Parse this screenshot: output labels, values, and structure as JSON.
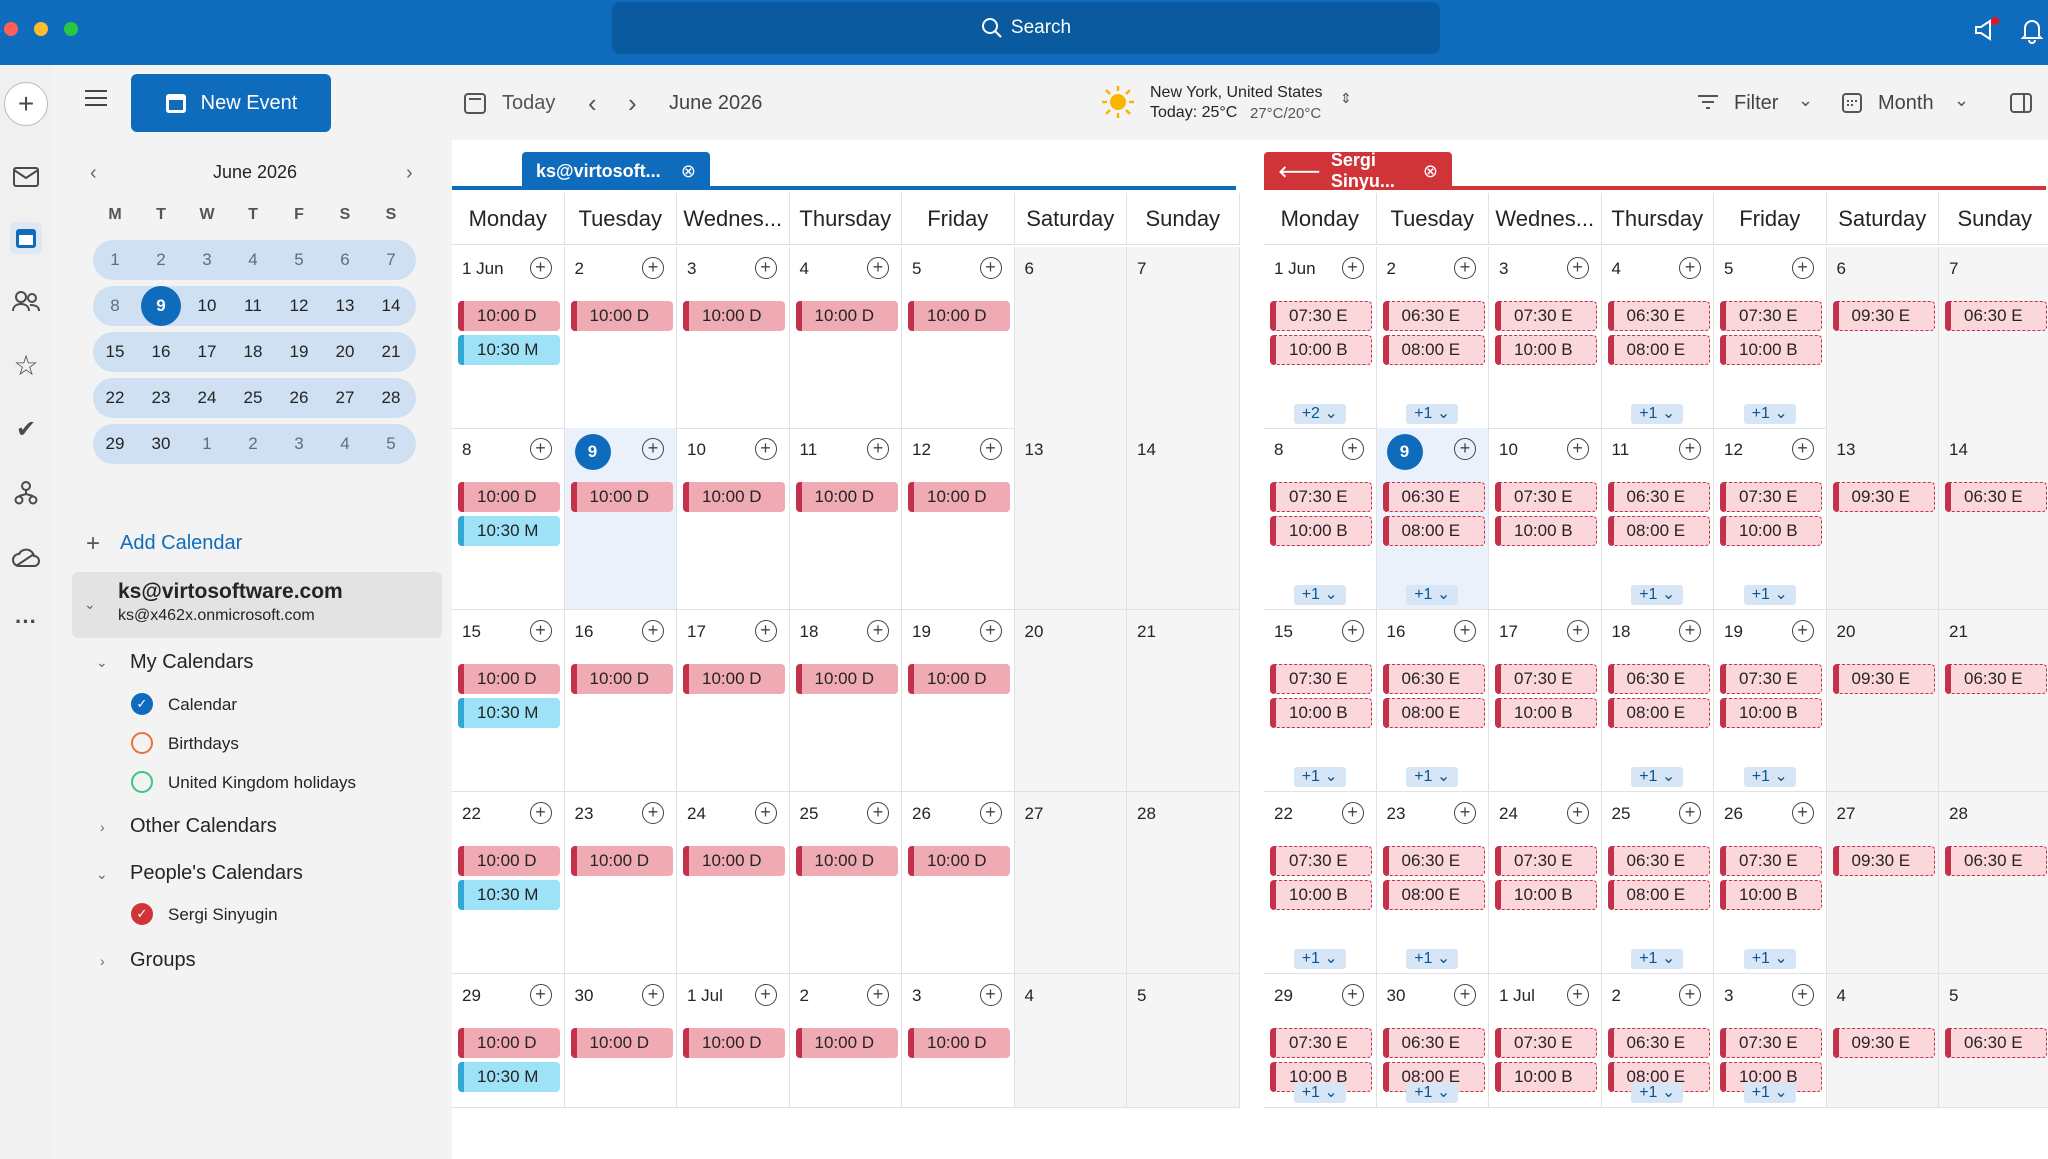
{
  "search": {
    "label": "Search"
  },
  "rail": {
    "items": [
      "add-icon",
      "mail-icon",
      "calendar-icon",
      "people-icon",
      "star-icon",
      "todo-icon",
      "org-icon",
      "cloud-icon",
      "more-icon"
    ]
  },
  "sidebar": {
    "new_event": "New Event",
    "mini_calendar": {
      "title": "June 2026",
      "dow": [
        "M",
        "T",
        "W",
        "T",
        "F",
        "S",
        "S"
      ],
      "weeks": [
        [
          "1",
          "2",
          "3",
          "4",
          "5",
          "6",
          "7"
        ],
        [
          "8",
          "9",
          "10",
          "11",
          "12",
          "13",
          "14"
        ],
        [
          "15",
          "16",
          "17",
          "18",
          "19",
          "20",
          "21"
        ],
        [
          "22",
          "23",
          "24",
          "25",
          "26",
          "27",
          "28"
        ],
        [
          "29",
          "30",
          "1",
          "2",
          "3",
          "4",
          "5"
        ]
      ],
      "today": "9"
    },
    "add_calendar": "Add Calendar",
    "account": {
      "name": "ks@virtosoftware.com",
      "email": "ks@x462x.onmicrosoft.com"
    },
    "my_calendars": "My Calendars",
    "calendars": [
      {
        "label": "Calendar",
        "color": "#0f6cbd",
        "checked": true
      },
      {
        "label": "Birthdays",
        "color": "#e8743b",
        "checked": false
      },
      {
        "label": "United Kingdom holidays",
        "color": "#3cc480",
        "checked": false
      }
    ],
    "other_calendars": "Other Calendars",
    "peoples_calendars": "People's Calendars",
    "people": [
      {
        "label": "Sergi Sinyugin",
        "color": "#d13438",
        "checked": true
      }
    ],
    "groups": "Groups"
  },
  "toolbar": {
    "today": "Today",
    "period": "June 2026",
    "weather": {
      "location": "New York, United States",
      "today": "Today: 25°C",
      "range": "27°C/20°C"
    },
    "filter": "Filter",
    "view": "Month"
  },
  "panes": [
    {
      "tab": "ks@virtosoft...",
      "accent": "#0f6cbd",
      "dow": [
        "Monday",
        "Tuesday",
        "Wednes...",
        "Thursday",
        "Friday",
        "Saturday",
        "Sunday"
      ],
      "weeks": [
        {
          "days": [
            "1 Jun",
            "2",
            "3",
            "4",
            "5",
            "6",
            "7"
          ],
          "events": [
            [
              [
                "10:00 D",
                "red"
              ],
              [
                "10:30 M",
                "blue"
              ]
            ],
            [
              [
                "10:00 D",
                "red"
              ]
            ],
            [
              [
                "10:00 D",
                "red"
              ]
            ],
            [
              [
                "10:00 D",
                "red"
              ]
            ],
            [
              [
                "10:00 D",
                "red"
              ]
            ],
            [],
            []
          ],
          "more": [
            "",
            "",
            "",
            "",
            "",
            "",
            ""
          ]
        },
        {
          "days": [
            "8",
            "9",
            "10",
            "11",
            "12",
            "13",
            "14"
          ],
          "events": [
            [
              [
                "10:00 D",
                "red"
              ],
              [
                "10:30 M",
                "blue"
              ]
            ],
            [
              [
                "10:00 D",
                "red"
              ]
            ],
            [
              [
                "10:00 D",
                "red"
              ]
            ],
            [
              [
                "10:00 D",
                "red"
              ]
            ],
            [
              [
                "10:00 D",
                "red"
              ]
            ],
            [],
            []
          ],
          "more": [
            "",
            "",
            "",
            "",
            "",
            "",
            ""
          ]
        },
        {
          "days": [
            "15",
            "16",
            "17",
            "18",
            "19",
            "20",
            "21"
          ],
          "events": [
            [
              [
                "10:00 D",
                "red"
              ],
              [
                "10:30 M",
                "blue"
              ]
            ],
            [
              [
                "10:00 D",
                "red"
              ]
            ],
            [
              [
                "10:00 D",
                "red"
              ]
            ],
            [
              [
                "10:00 D",
                "red"
              ]
            ],
            [
              [
                "10:00 D",
                "red"
              ]
            ],
            [],
            []
          ],
          "more": [
            "",
            "",
            "",
            "",
            "",
            "",
            ""
          ]
        },
        {
          "days": [
            "22",
            "23",
            "24",
            "25",
            "26",
            "27",
            "28"
          ],
          "events": [
            [
              [
                "10:00 D",
                "red"
              ],
              [
                "10:30 M",
                "blue"
              ]
            ],
            [
              [
                "10:00 D",
                "red"
              ]
            ],
            [
              [
                "10:00 D",
                "red"
              ]
            ],
            [
              [
                "10:00 D",
                "red"
              ]
            ],
            [
              [
                "10:00 D",
                "red"
              ]
            ],
            [],
            []
          ],
          "more": [
            "",
            "",
            "",
            "",
            "",
            "",
            ""
          ]
        },
        {
          "days": [
            "29",
            "30",
            "1 Jul",
            "2",
            "3",
            "4",
            "5"
          ],
          "events": [
            [
              [
                "10:00 D",
                "red"
              ],
              [
                "10:30 M",
                "blue"
              ]
            ],
            [
              [
                "10:00 D",
                "red"
              ]
            ],
            [
              [
                "10:00 D",
                "red"
              ]
            ],
            [
              [
                "10:00 D",
                "red"
              ]
            ],
            [
              [
                "10:00 D",
                "red"
              ]
            ],
            [],
            []
          ],
          "more": [
            "",
            "",
            "",
            "",
            "",
            "",
            ""
          ]
        }
      ]
    },
    {
      "tab": "Sergi Sinyu...",
      "accent": "#d13438",
      "dow": [
        "Monday",
        "Tuesday",
        "Wednes...",
        "Thursday",
        "Friday",
        "Saturday",
        "Sunday"
      ],
      "weeks": [
        {
          "days": [
            "1 Jun",
            "2",
            "3",
            "4",
            "5",
            "6",
            "7"
          ],
          "events": [
            [
              [
                "07:30 E",
                "dash"
              ],
              [
                "10:00 B",
                "dash"
              ]
            ],
            [
              [
                "06:30 E",
                "dash"
              ],
              [
                "08:00 E",
                "dash"
              ]
            ],
            [
              [
                "07:30 E",
                "dash"
              ],
              [
                "10:00 B",
                "dash"
              ]
            ],
            [
              [
                "06:30 E",
                "dash"
              ],
              [
                "08:00 E",
                "dash"
              ]
            ],
            [
              [
                "07:30 E",
                "dash"
              ],
              [
                "10:00 B",
                "dash"
              ]
            ],
            [
              [
                "09:30 E",
                "dash"
              ]
            ],
            [
              [
                "06:30 E",
                "dash"
              ]
            ]
          ],
          "more": [
            "+2 ⌄",
            "+1 ⌄",
            "",
            "+1 ⌄",
            "+1 ⌄",
            "",
            ""
          ]
        },
        {
          "days": [
            "8",
            "9",
            "10",
            "11",
            "12",
            "13",
            "14"
          ],
          "events": [
            [
              [
                "07:30 E",
                "dash"
              ],
              [
                "10:00 B",
                "dash"
              ]
            ],
            [
              [
                "06:30 E",
                "dash"
              ],
              [
                "08:00 E",
                "dash"
              ]
            ],
            [
              [
                "07:30 E",
                "dash"
              ],
              [
                "10:00 B",
                "dash"
              ]
            ],
            [
              [
                "06:30 E",
                "dash"
              ],
              [
                "08:00 E",
                "dash"
              ]
            ],
            [
              [
                "07:30 E",
                "dash"
              ],
              [
                "10:00 B",
                "dash"
              ]
            ],
            [
              [
                "09:30 E",
                "dash"
              ]
            ],
            [
              [
                "06:30 E",
                "dash"
              ]
            ]
          ],
          "more": [
            "+1 ⌄",
            "+1 ⌄",
            "",
            "+1 ⌄",
            "+1 ⌄",
            "",
            ""
          ]
        },
        {
          "days": [
            "15",
            "16",
            "17",
            "18",
            "19",
            "20",
            "21"
          ],
          "events": [
            [
              [
                "07:30 E",
                "dash"
              ],
              [
                "10:00 B",
                "dash"
              ]
            ],
            [
              [
                "06:30 E",
                "dash"
              ],
              [
                "08:00 E",
                "dash"
              ]
            ],
            [
              [
                "07:30 E",
                "dash"
              ],
              [
                "10:00 B",
                "dash"
              ]
            ],
            [
              [
                "06:30 E",
                "dash"
              ],
              [
                "08:00 E",
                "dash"
              ]
            ],
            [
              [
                "07:30 E",
                "dash"
              ],
              [
                "10:00 B",
                "dash"
              ]
            ],
            [
              [
                "09:30 E",
                "dash"
              ]
            ],
            [
              [
                "06:30 E",
                "dash"
              ]
            ]
          ],
          "more": [
            "+1 ⌄",
            "+1 ⌄",
            "",
            "+1 ⌄",
            "+1 ⌄",
            "",
            ""
          ]
        },
        {
          "days": [
            "22",
            "23",
            "24",
            "25",
            "26",
            "27",
            "28"
          ],
          "events": [
            [
              [
                "07:30 E",
                "dash"
              ],
              [
                "10:00 B",
                "dash"
              ]
            ],
            [
              [
                "06:30 E",
                "dash"
              ],
              [
                "08:00 E",
                "dash"
              ]
            ],
            [
              [
                "07:30 E",
                "dash"
              ],
              [
                "10:00 B",
                "dash"
              ]
            ],
            [
              [
                "06:30 E",
                "dash"
              ],
              [
                "08:00 E",
                "dash"
              ]
            ],
            [
              [
                "07:30 E",
                "dash"
              ],
              [
                "10:00 B",
                "dash"
              ]
            ],
            [
              [
                "09:30 E",
                "dash"
              ]
            ],
            [
              [
                "06:30 E",
                "dash"
              ]
            ]
          ],
          "more": [
            "+1 ⌄",
            "+1 ⌄",
            "",
            "+1 ⌄",
            "+1 ⌄",
            "",
            ""
          ]
        },
        {
          "days": [
            "29",
            "30",
            "1 Jul",
            "2",
            "3",
            "4",
            "5"
          ],
          "events": [
            [
              [
                "07:30 E",
                "dash"
              ],
              [
                "10:00 B",
                "dash"
              ]
            ],
            [
              [
                "06:30 E",
                "dash"
              ],
              [
                "08:00 E",
                "dash"
              ]
            ],
            [
              [
                "07:30 E",
                "dash"
              ],
              [
                "10:00 B",
                "dash"
              ]
            ],
            [
              [
                "06:30 E",
                "dash"
              ],
              [
                "08:00 E",
                "dash"
              ]
            ],
            [
              [
                "07:30 E",
                "dash"
              ],
              [
                "10:00 B",
                "dash"
              ]
            ],
            [
              [
                "09:30 E",
                "dash"
              ]
            ],
            [
              [
                "06:30 E",
                "dash"
              ]
            ]
          ],
          "more": [
            "+1 ⌄",
            "+1 ⌄",
            "",
            "+1 ⌄",
            "+1 ⌄",
            "",
            ""
          ]
        }
      ]
    }
  ]
}
